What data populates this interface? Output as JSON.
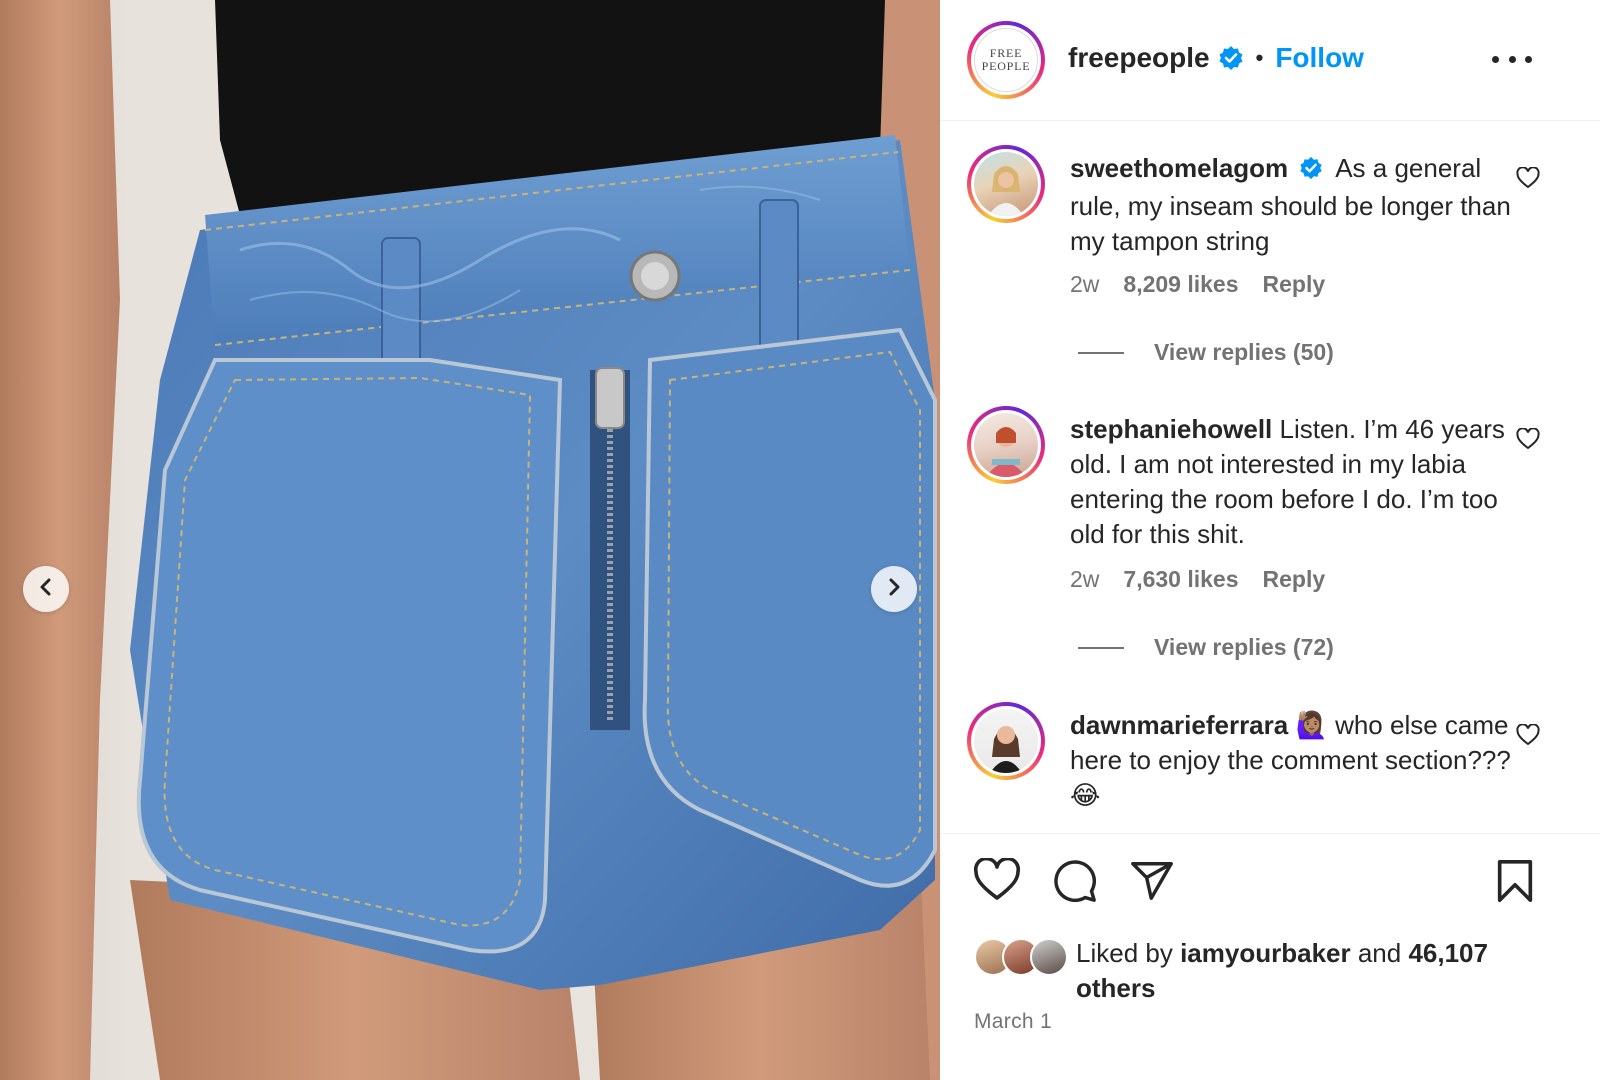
{
  "post": {
    "author": "freepeople",
    "author_logo_line1": "FREE",
    "author_logo_line2": "PEOPLE",
    "separator": "•",
    "follow_label": "Follow",
    "date": "March 1"
  },
  "comments": [
    {
      "username": "sweethomelagom",
      "verified": true,
      "text": "As a general rule, my inseam should be longer than my tampon string",
      "age": "2w",
      "likes": "8,209 likes",
      "reply_label": "Reply",
      "view_replies": "View replies (50)"
    },
    {
      "username": "stephaniehowell",
      "verified": false,
      "text": "Listen. I’m 46 years old. I am not interested in my labia entering the room before I do. I’m too old for this shit.",
      "age": "2w",
      "likes": "7,630 likes",
      "reply_label": "Reply",
      "view_replies": "View replies (72)"
    },
    {
      "username": "dawnmarieferrara",
      "verified": false,
      "text": "🙋🏽‍♀️ who else came here to enjoy the comment section??? 😂"
    }
  ],
  "liked_by": {
    "prefix": "Liked by ",
    "user": "iamyourbaker",
    "middle": " and ",
    "count": "46,107 others"
  },
  "icons": {
    "verified": "verified-badge-icon",
    "more": "more-options-icon",
    "prev": "chevron-left-icon",
    "next": "chevron-right-icon",
    "heart": "heart-icon",
    "comment": "comment-icon",
    "share": "share-icon",
    "save": "bookmark-icon"
  },
  "colors": {
    "follow_blue": "#0095f6",
    "verified_blue": "#0095f6",
    "text_primary": "#262626",
    "text_secondary": "#737373"
  }
}
